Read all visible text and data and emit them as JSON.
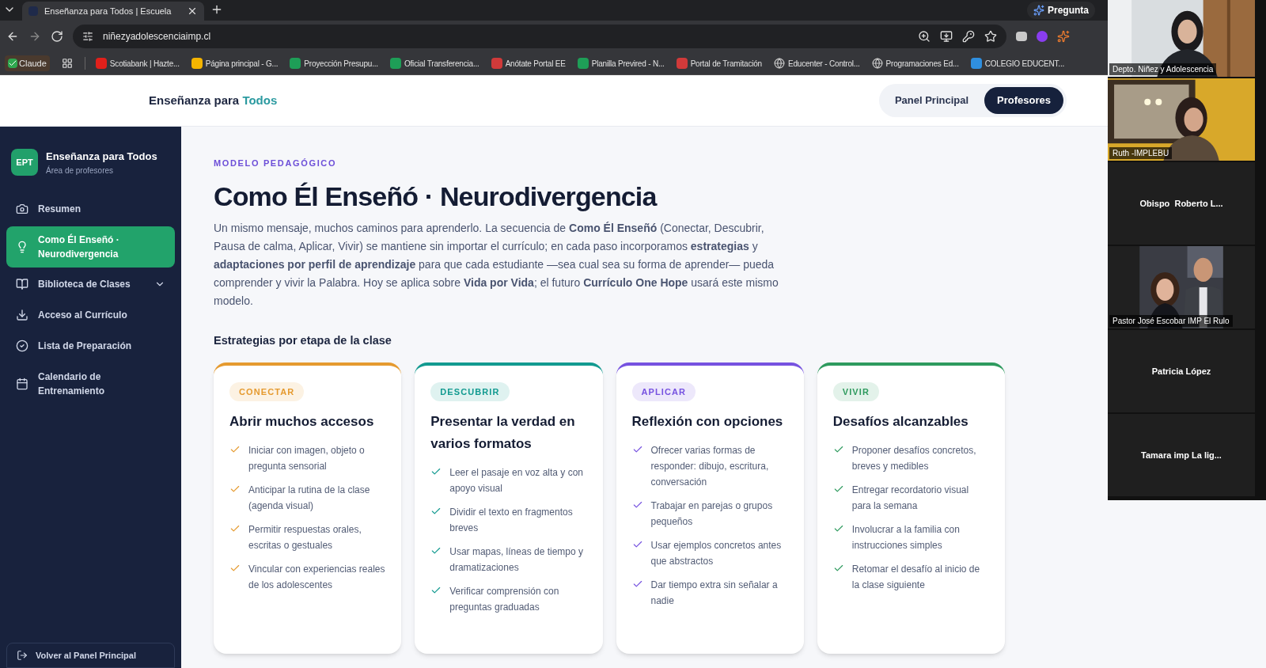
{
  "browser": {
    "tab": {
      "title": "Enseñanza para Todos | Escuela"
    },
    "url": "niñezyadolescenciaimp.cl",
    "ask_button": "Pregunta",
    "bookmarks": [
      {
        "label": "Claude",
        "kind": "badge",
        "color": "#2fa84f"
      },
      {
        "label": "Scotiabank | Hazte...",
        "kind": "favicon",
        "color": "#e0201b"
      },
      {
        "label": "Página principal - G...",
        "kind": "favicon",
        "color": "#f4b400"
      },
      {
        "label": "Proyección Presupu...",
        "kind": "favicon",
        "color": "#1e9e57"
      },
      {
        "label": "Oficial Transferencia...",
        "kind": "favicon",
        "color": "#1e9e57"
      },
      {
        "label": "Anótate Portal EE",
        "kind": "favicon",
        "color": "#d03a3a"
      },
      {
        "label": "Planilla Previred - N...",
        "kind": "favicon",
        "color": "#1e9e57"
      },
      {
        "label": "Portal de Tramitación",
        "kind": "favicon",
        "color": "#d03a3a"
      },
      {
        "label": "Educenter - Control...",
        "kind": "globe",
        "color": "#c8c8c8"
      },
      {
        "label": "Programaciones Ed...",
        "kind": "globe",
        "color": "#c8c8c8"
      },
      {
        "label": "COLEGIO EDUCENT...",
        "kind": "favicon",
        "color": "#2f8fe0"
      }
    ]
  },
  "site_header": {
    "brand": "Enseñanza para ",
    "brand_accent": "Todos",
    "tabs": [
      {
        "label": "Panel Principal",
        "selected": false
      },
      {
        "label": "Profesores",
        "selected": true
      }
    ]
  },
  "sidebar": {
    "logo": "EPT",
    "title": "Enseñanza para Todos",
    "subtitle": "Área de profesores",
    "items": [
      {
        "label": "Resumen",
        "selected": false,
        "expandable": false
      },
      {
        "label": "Como Él Enseñó · Neurodivergencia",
        "selected": true,
        "expandable": false
      },
      {
        "label": "Biblioteca de Clases",
        "selected": false,
        "expandable": true
      },
      {
        "label": "Acceso al Currículo",
        "selected": false,
        "expandable": false
      },
      {
        "label": "Lista de Preparación",
        "selected": false,
        "expandable": false
      },
      {
        "label": "Calendario de Entrenamiento",
        "selected": false,
        "expandable": false
      }
    ],
    "footer_button": "Volver al Panel Principal"
  },
  "main": {
    "eyebrow": "MODELO PEDAGÓGICO",
    "title": "Como Él Enseñó · Neurodivergencia",
    "intro": "Un mismo mensaje, muchos caminos para aprenderlo. La secuencia de **Como Él Enseñó** (Conectar, Descubrir, Pausa de calma, Aplicar, Vivir) se mantiene sin importar el currículo; en cada paso incorporamos **estrategias** y **adaptaciones por perfil de aprendizaje** para que cada estudiante —sea cual sea su forma de aprender— pueda comprender y vivir la Palabra. Hoy se aplica sobre **Vida por Vida**; el futuro **Currículo One Hope** usará este mismo modelo.",
    "section_title": "Estrategias por etapa de la clase",
    "cards": [
      {
        "tag": "CONECTAR",
        "color": "#e59a2f",
        "title": "Abrir muchos accesos",
        "items": [
          "Iniciar con imagen, objeto o pregunta sensorial",
          "Anticipar la rutina de la clase (agenda visual)",
          "Permitir respuestas orales, escritas o gestuales",
          "Vincular con experiencias reales de los adolescentes"
        ]
      },
      {
        "tag": "DESCUBRIR",
        "color": "#129a90",
        "title": "Presentar la verdad en varios formatos",
        "items": [
          "Leer el pasaje en voz alta y con apoyo visual",
          "Dividir el texto en fragmentos breves",
          "Usar mapas, líneas de tiempo y dramatizaciones",
          "Verificar comprensión con preguntas graduadas"
        ]
      },
      {
        "tag": "APLICAR",
        "color": "#7652e0",
        "title": "Reflexión con opciones",
        "items": [
          "Ofrecer varias formas de responder: dibujo, escritura, conversación",
          "Trabajar en parejas o grupos pequeños",
          "Usar ejemplos concretos antes que abstractos",
          "Dar tiempo extra sin señalar a nadie"
        ]
      },
      {
        "tag": "VIVIR",
        "color": "#2e9a5e",
        "title": "Desafíos alcanzables",
        "items": [
          "Proponer desafíos concretos, breves y medibles",
          "Entregar recordatorio visual para la semana",
          "Involucrar a la familia con instrucciones simples",
          "Retomar el desafío al inicio de la clase siguiente"
        ]
      }
    ]
  },
  "call_participants": [
    {
      "name": "Depto. Niñez y Adolescencia",
      "kind": "video"
    },
    {
      "name": "Ruth -IMPLEBU",
      "kind": "video"
    },
    {
      "name": "Obispo  Roberto L...",
      "kind": "avatar"
    },
    {
      "name": "Pastor José Escobar IMP El Rulo",
      "kind": "video"
    },
    {
      "name": "Patricia López",
      "kind": "avatar"
    },
    {
      "name": "Tamara imp La lig...",
      "kind": "avatar"
    }
  ]
}
